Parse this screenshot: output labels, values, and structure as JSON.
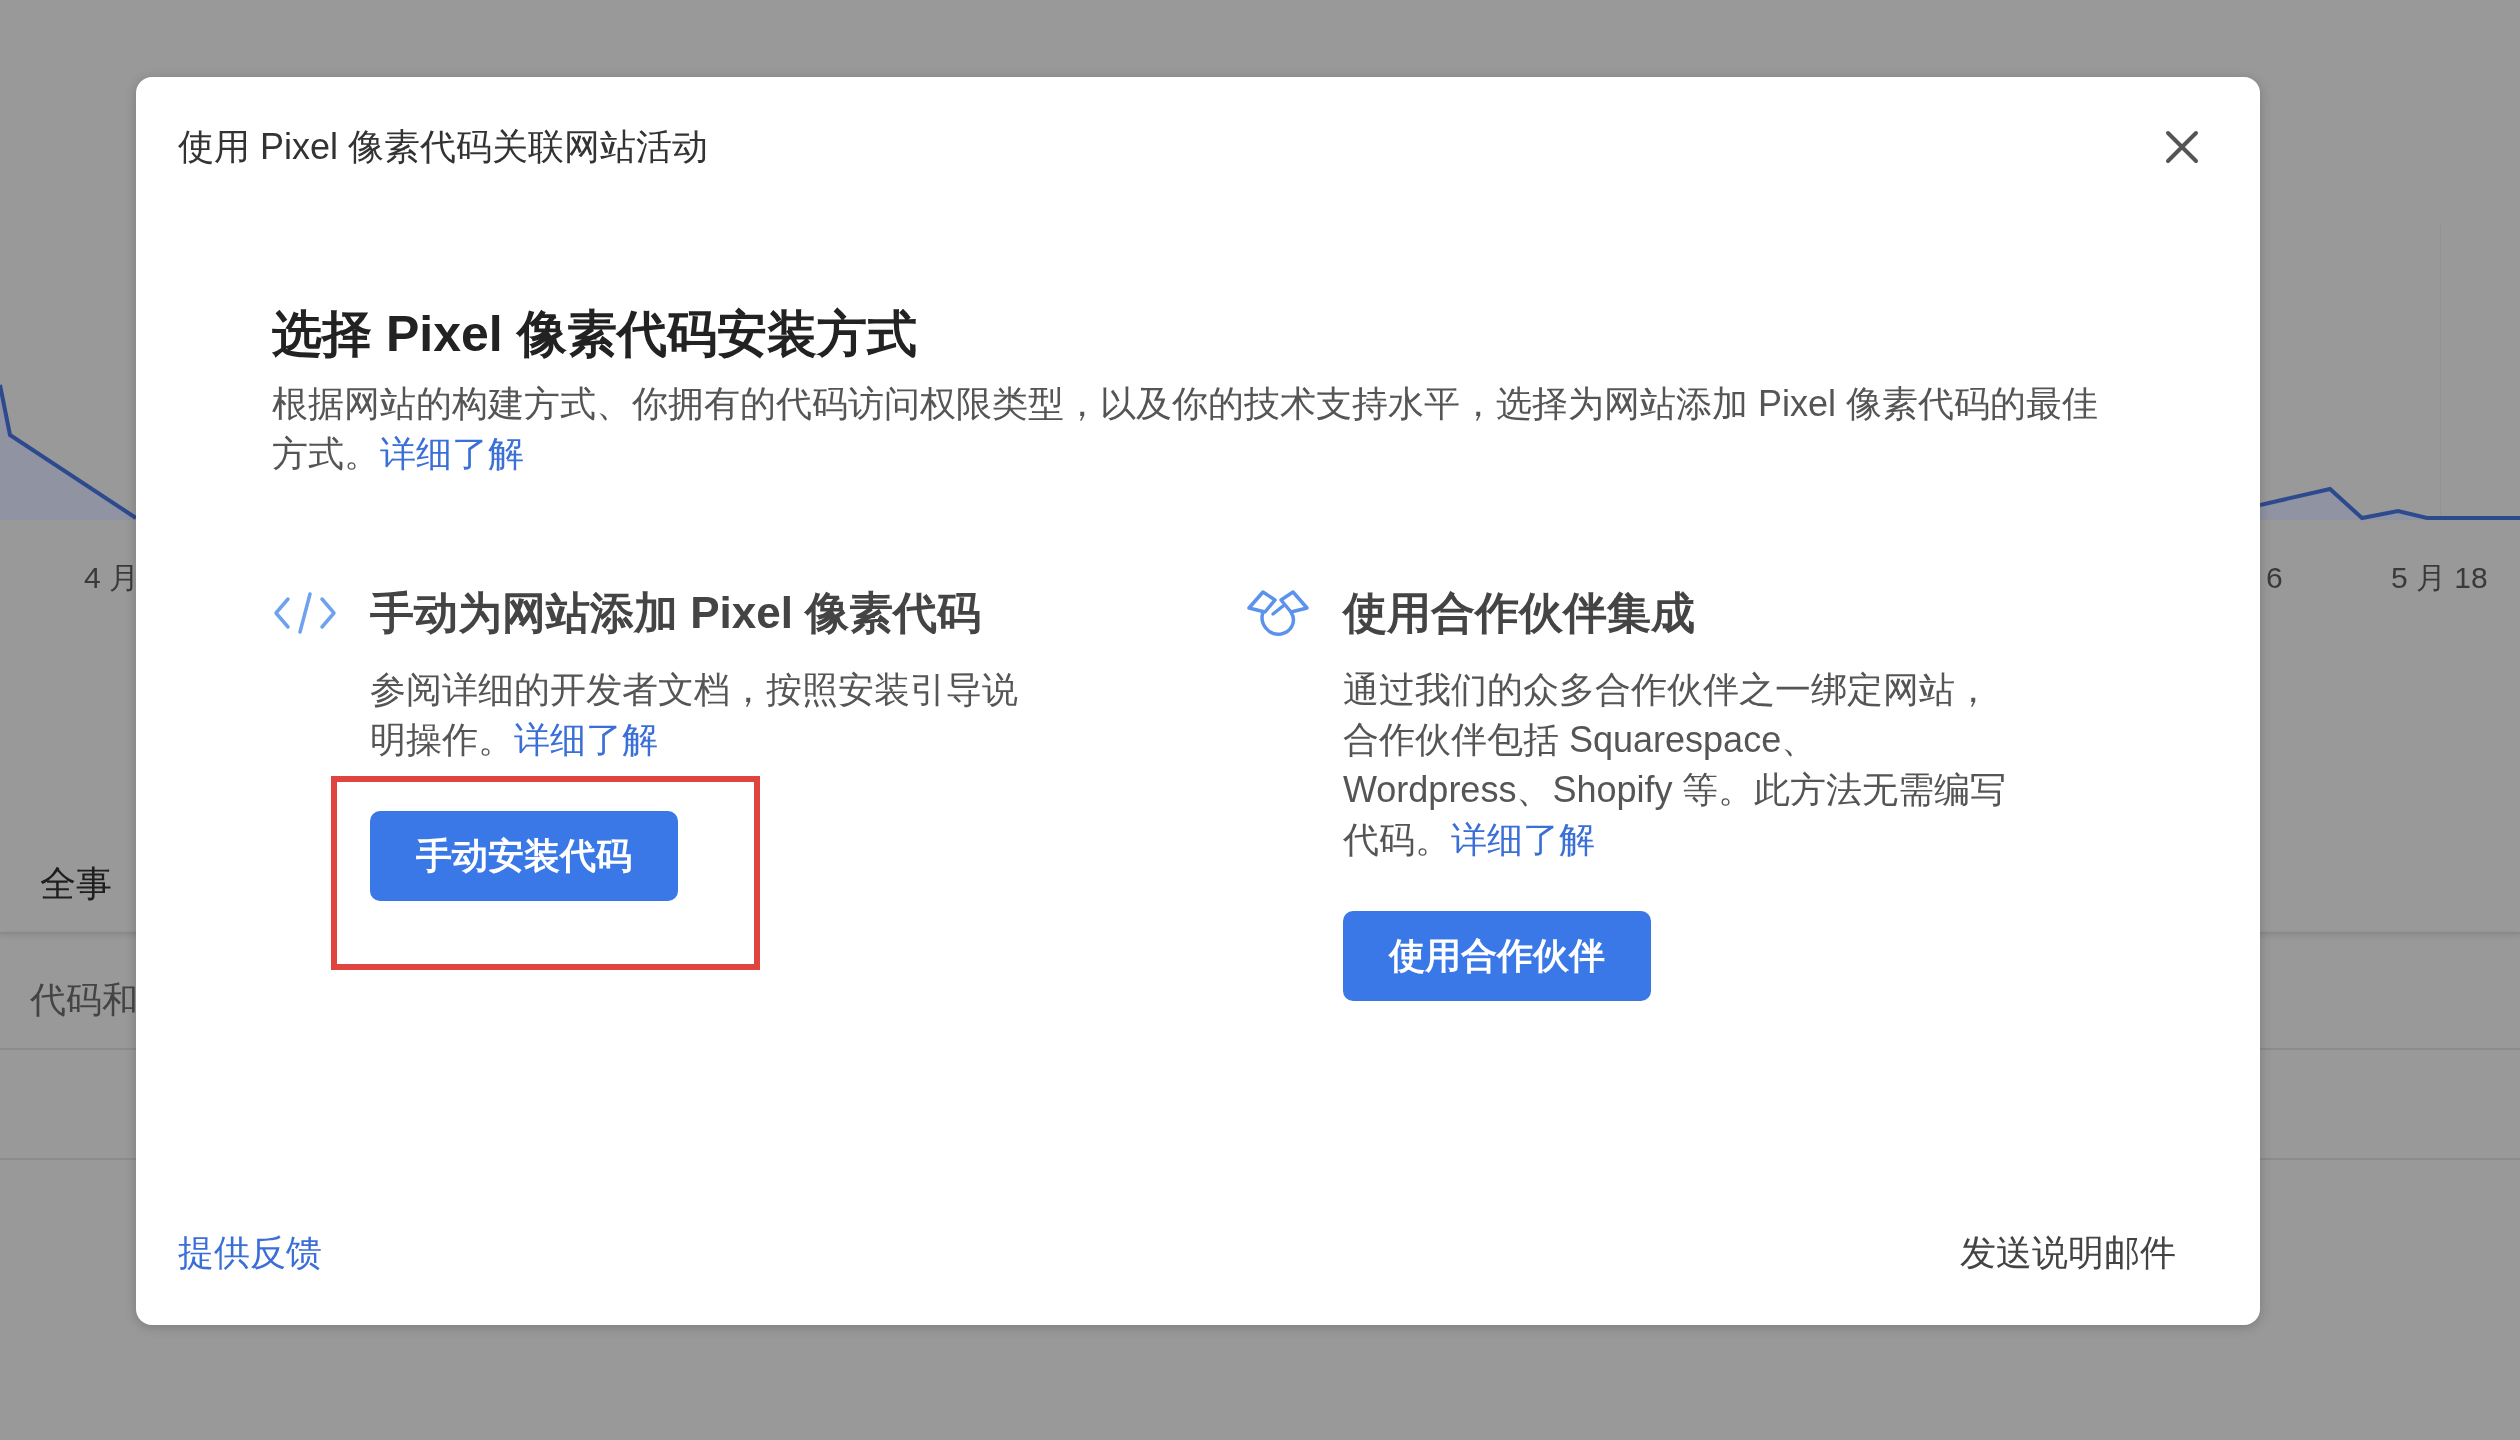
{
  "background": {
    "axis_labels": [
      "4 月",
      "6",
      "5 月 18"
    ],
    "section_label": "全事",
    "table_text": "代码和"
  },
  "dialog": {
    "title": "使用 Pixel 像素代码关联网站活动",
    "heading": "选择 Pixel 像素代码安装方式",
    "description": {
      "text": "根据网站的构建方式、你拥有的代码访问权限类型，以及你的技术支持水平，选择为网站添加 Pixel 像素代码的最佳方式。",
      "link": "详细了解"
    },
    "options": [
      {
        "kind": "code",
        "title": "手动为网站添加 Pixel 像素代码",
        "description": "参阅详细的开发者文档，按照安装引导说明操作。",
        "link": "详细了解",
        "button": "手动安装代码",
        "highlighted": true
      },
      {
        "kind": "partner",
        "title": "使用合作伙伴集成",
        "description": "通过我们的众多合作伙伴之一绑定网站，合作伙伴包括 Squarespace、Wordpress、Shopify 等。此方法无需编写代码。",
        "link": "详细了解",
        "button": "使用合作伙伴",
        "highlighted": false
      }
    ],
    "footer": {
      "feedback_link": "提供反馈",
      "email_link": "发送说明邮件"
    }
  }
}
